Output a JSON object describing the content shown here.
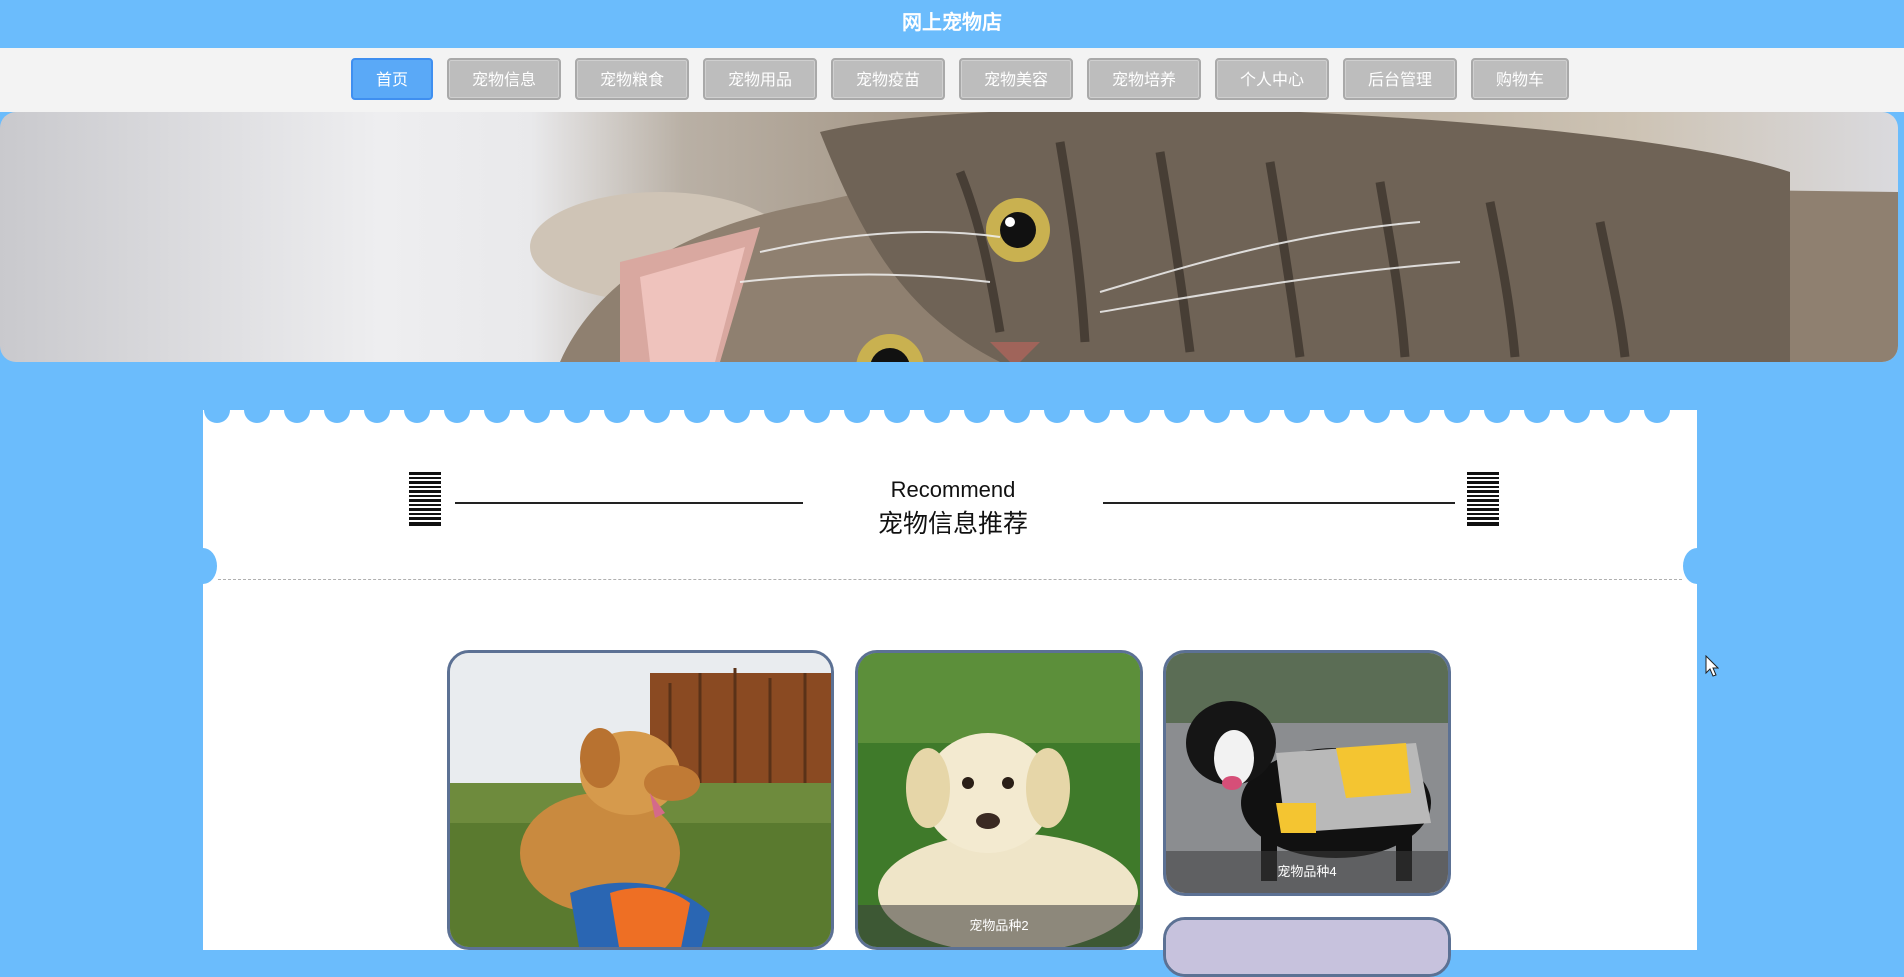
{
  "header": {
    "title": "网上宠物店"
  },
  "nav": {
    "items": [
      {
        "label": "首页",
        "active": true
      },
      {
        "label": "宠物信息",
        "active": false
      },
      {
        "label": "宠物粮食",
        "active": false
      },
      {
        "label": "宠物用品",
        "active": false
      },
      {
        "label": "宠物疫苗",
        "active": false
      },
      {
        "label": "宠物美容",
        "active": false
      },
      {
        "label": "宠物培养",
        "active": false
      },
      {
        "label": "个人中心",
        "active": false
      },
      {
        "label": "后台管理",
        "active": false
      },
      {
        "label": "购物车",
        "active": false
      }
    ]
  },
  "banner": {
    "icon": "cat-photo"
  },
  "recommend": {
    "title_en": "Recommend",
    "title_cn": "宠物信息推荐",
    "cards": [
      {
        "caption": "",
        "icon": "golden-retriever-photo"
      },
      {
        "caption": "宠物品种2",
        "icon": "labrador-puppy-photo"
      },
      {
        "caption": "宠物品种4",
        "icon": "border-collie-photo"
      },
      {
        "caption": "",
        "icon": "pet-photo"
      }
    ]
  },
  "colors": {
    "brand": "#6bbcfc",
    "nav_active": "#5aa9f7",
    "nav_inactive": "#bdbdbd",
    "card_border": "#5c7194"
  }
}
